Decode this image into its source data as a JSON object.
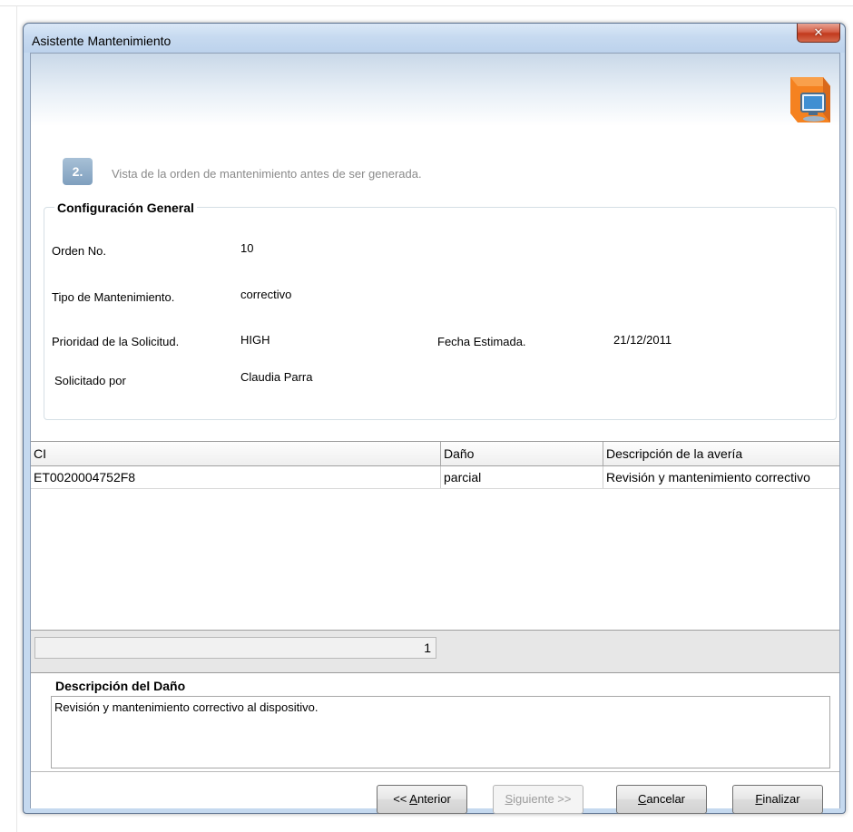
{
  "window": {
    "title": "Asistente Mantenimiento",
    "close_glyph": "✕"
  },
  "step": {
    "number": "2.",
    "description": "Vista de la orden de mantenimiento antes de ser generada."
  },
  "config": {
    "title": "Configuración General",
    "orden_label": "Orden No.",
    "orden_value": "10",
    "tipo_label": "Tipo de Mantenimiento.",
    "tipo_value": "correctivo",
    "prioridad_label": "Prioridad de la Solicitud.",
    "prioridad_value": "HIGH",
    "fecha_label": "Fecha Estimada.",
    "fecha_value": "21/12/2011",
    "solicitado_label": "Solicitado por",
    "solicitado_value": "Claudia Parra"
  },
  "grid": {
    "columns": [
      "CI",
      "Daño",
      "Descripción de la avería"
    ],
    "rows": [
      [
        "ET0020004752F8",
        "parcial",
        "Revisión y mantenimiento correctivo"
      ]
    ],
    "footer_count": "1"
  },
  "damage": {
    "title": "Descripción del Daño",
    "text": "Revisión y mantenimiento correctivo al dispositivo."
  },
  "buttons": {
    "anterior_prefix": "<< ",
    "anterior_mnemonic": "A",
    "anterior_rest": "nterior",
    "siguiente_mnemonic": "S",
    "siguiente_rest": "iguiente >>",
    "cancelar_mnemonic": "C",
    "cancelar_rest": "ancelar",
    "finalizar_mnemonic": "F",
    "finalizar_rest": "inalizar"
  },
  "icons": {
    "wizard": "computer-wizard-icon",
    "close": "close-icon"
  }
}
